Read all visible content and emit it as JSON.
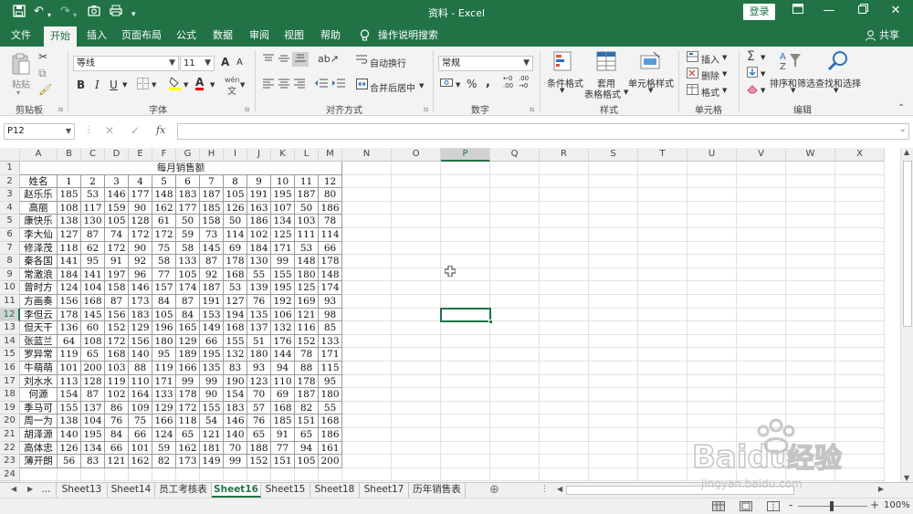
{
  "titlebar": {
    "title": "资料 - Excel",
    "login": "登录",
    "icons": [
      "save-icon",
      "undo-icon",
      "redo-icon",
      "camera-icon",
      "print-icon",
      "customize-icon"
    ]
  },
  "tabs": [
    {
      "label": "文件"
    },
    {
      "label": "开始",
      "active": true
    },
    {
      "label": "插入"
    },
    {
      "label": "页面布局"
    },
    {
      "label": "公式"
    },
    {
      "label": "数据"
    },
    {
      "label": "审阅"
    },
    {
      "label": "视图"
    },
    {
      "label": "帮助"
    }
  ],
  "tell_me": "操作说明搜索",
  "share": "共享",
  "ribbon": {
    "clipboard": {
      "paste": "粘贴",
      "label": "剪贴板"
    },
    "font": {
      "name": "等线",
      "size": "11",
      "label": "字体",
      "grow": "A",
      "shrink": "A",
      "bold": "B",
      "italic": "I",
      "underline": "U",
      "color_a": "A",
      "phonetic": "wén"
    },
    "alignment": {
      "wrap": "自动换行",
      "merge": "合并后居中",
      "label": "对齐方式"
    },
    "number": {
      "format": "常规",
      "label": "数字",
      "percent": "%",
      "comma": ","
    },
    "styles": {
      "conditional": "条件格式",
      "table_1": "套用",
      "table_2": "表格格式",
      "cell_styles": "单元格样式",
      "label": "样式"
    },
    "cells": {
      "insert": "插入",
      "delete": "删除",
      "format": "格式",
      "label": "单元格"
    },
    "editing": {
      "sort": "排序和筛选",
      "find": "查找和选择",
      "label": "编辑"
    }
  },
  "formula_bar": {
    "name_box": "P12",
    "cancel": "✕",
    "enter": "✓",
    "fx": "fx",
    "value": ""
  },
  "columns": [
    "A",
    "B",
    "C",
    "D",
    "E",
    "F",
    "G",
    "H",
    "I",
    "J",
    "K",
    "L",
    "M",
    "N",
    "O",
    "P",
    "Q",
    "R",
    "S",
    "T",
    "U",
    "V",
    "W",
    "X"
  ],
  "selected_cell": "P12",
  "sheet": {
    "title": "每月销售额",
    "header": [
      "姓名",
      "1",
      "2",
      "3",
      "4",
      "5",
      "6",
      "7",
      "8",
      "9",
      "10",
      "11",
      "12"
    ],
    "rows": [
      [
        "赵乐乐",
        "185",
        "53",
        "146",
        "177",
        "148",
        "183",
        "187",
        "105",
        "191",
        "195",
        "187",
        "80"
      ],
      [
        "高丽",
        "108",
        "117",
        "159",
        "90",
        "162",
        "177",
        "185",
        "126",
        "163",
        "107",
        "50",
        "186"
      ],
      [
        "康快乐",
        "138",
        "130",
        "105",
        "128",
        "61",
        "50",
        "158",
        "50",
        "186",
        "134",
        "103",
        "78"
      ],
      [
        "李大仙",
        "127",
        "87",
        "74",
        "172",
        "172",
        "59",
        "73",
        "114",
        "102",
        "125",
        "111",
        "114"
      ],
      [
        "修泽茂",
        "118",
        "62",
        "172",
        "90",
        "75",
        "58",
        "145",
        "69",
        "184",
        "171",
        "53",
        "66"
      ],
      [
        "秦各国",
        "141",
        "95",
        "91",
        "92",
        "58",
        "133",
        "87",
        "178",
        "130",
        "99",
        "148",
        "178"
      ],
      [
        "常激浪",
        "184",
        "141",
        "197",
        "96",
        "77",
        "105",
        "92",
        "168",
        "55",
        "155",
        "180",
        "148"
      ],
      [
        "曾时方",
        "124",
        "104",
        "158",
        "146",
        "157",
        "174",
        "187",
        "53",
        "139",
        "195",
        "125",
        "174"
      ],
      [
        "方画奏",
        "156",
        "168",
        "87",
        "173",
        "84",
        "87",
        "191",
        "127",
        "76",
        "192",
        "169",
        "93"
      ],
      [
        "李但云",
        "178",
        "145",
        "156",
        "183",
        "105",
        "84",
        "153",
        "194",
        "135",
        "106",
        "121",
        "98"
      ],
      [
        "但天干",
        "136",
        "60",
        "152",
        "129",
        "196",
        "165",
        "149",
        "168",
        "137",
        "132",
        "116",
        "85"
      ],
      [
        "张蓝兰",
        "64",
        "108",
        "172",
        "156",
        "180",
        "129",
        "66",
        "155",
        "51",
        "176",
        "152",
        "133"
      ],
      [
        "罗异常",
        "119",
        "65",
        "168",
        "140",
        "95",
        "189",
        "195",
        "132",
        "180",
        "144",
        "78",
        "171"
      ],
      [
        "牛萌萌",
        "101",
        "200",
        "103",
        "88",
        "119",
        "166",
        "135",
        "83",
        "93",
        "94",
        "88",
        "115"
      ],
      [
        "刘水水",
        "113",
        "128",
        "119",
        "110",
        "171",
        "99",
        "99",
        "190",
        "123",
        "110",
        "178",
        "95"
      ],
      [
        "何源",
        "154",
        "87",
        "102",
        "164",
        "133",
        "178",
        "90",
        "154",
        "70",
        "69",
        "187",
        "180"
      ],
      [
        "季马可",
        "155",
        "137",
        "86",
        "109",
        "129",
        "172",
        "155",
        "183",
        "57",
        "168",
        "82",
        "55"
      ],
      [
        "周一为",
        "138",
        "104",
        "76",
        "75",
        "166",
        "118",
        "54",
        "146",
        "76",
        "185",
        "151",
        "168"
      ],
      [
        "胡泽源",
        "140",
        "195",
        "84",
        "66",
        "124",
        "65",
        "121",
        "140",
        "65",
        "91",
        "65",
        "186"
      ],
      [
        "高体忠",
        "126",
        "134",
        "66",
        "101",
        "59",
        "162",
        "181",
        "70",
        "188",
        "77",
        "94",
        "161"
      ],
      [
        "薄开朗",
        "56",
        "83",
        "121",
        "162",
        "82",
        "173",
        "149",
        "99",
        "152",
        "151",
        "105",
        "200"
      ]
    ]
  },
  "sheet_tabs": [
    {
      "label": "..."
    },
    {
      "label": "Sheet13"
    },
    {
      "label": "Sheet14"
    },
    {
      "label": "员工考核表"
    },
    {
      "label": "Sheet16",
      "active": true
    },
    {
      "label": "Sheet15"
    },
    {
      "label": "Sheet18"
    },
    {
      "label": "Sheet17"
    },
    {
      "label": "历年销售表"
    }
  ],
  "status": {
    "zoom": "100%",
    "zoom_minus": "-",
    "zoom_plus": "+"
  },
  "watermark": {
    "brand": "Baidu",
    "cn": "经验",
    "url": "jingyan.baidu.com"
  },
  "colors": {
    "accent": "#217346"
  }
}
